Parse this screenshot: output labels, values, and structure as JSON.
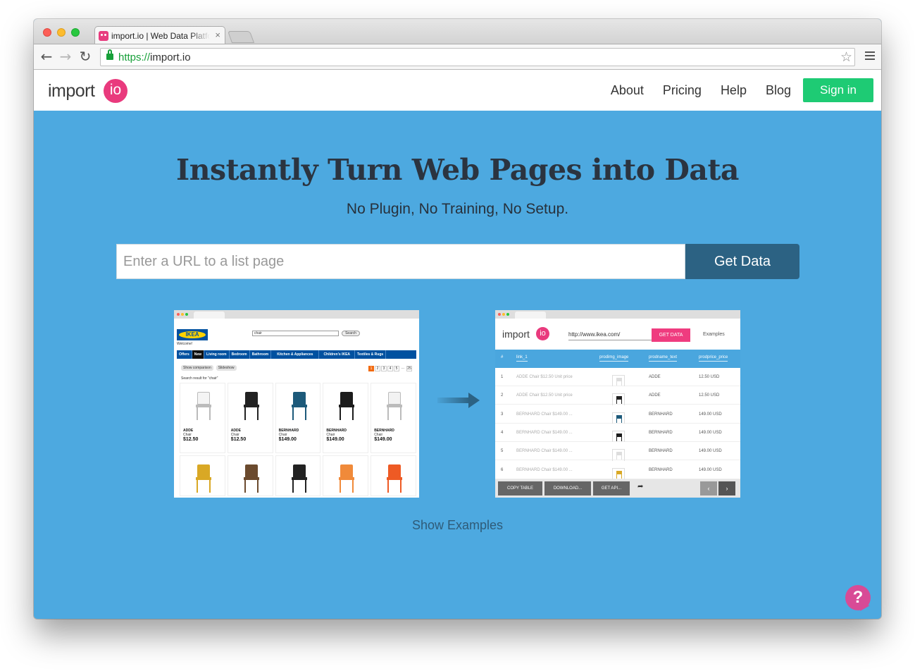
{
  "browser": {
    "tab_title": "import.io | Web Data Platform",
    "tab_close": "×",
    "url_scheme": "https://",
    "url_host": "import.io",
    "back_icon": "←",
    "forward_icon": "→",
    "reload_icon": "↻",
    "star_icon": "☆"
  },
  "header": {
    "logo_text": "import",
    "logo_badge": "io",
    "nav": [
      "About",
      "Pricing",
      "Help",
      "Blog"
    ],
    "signin_label": "Sign in"
  },
  "hero": {
    "title": "Instantly Turn Web Pages into Data",
    "subtitle": "No Plugin, No Training, No Setup.",
    "input_placeholder": "Enter a URL to a list page",
    "button_label": "Get Data"
  },
  "ikea_mock": {
    "logo": "IKEA",
    "welcome": "Welcome!",
    "search_value": "chair",
    "search_button": "Search",
    "nav": [
      "Offers",
      "New",
      "Living room",
      "Bedroom",
      "Bathroom",
      "Kitchen & Appliances",
      "Children's IKEA",
      "Textiles & Rugs"
    ],
    "pills": [
      "Show comparison",
      "Slideshow"
    ],
    "pages": [
      "1",
      "2",
      "3",
      "4",
      "5",
      "...",
      "25"
    ],
    "result_text": "Search result for \"chair\"",
    "products": [
      {
        "name": "ADDE",
        "type": "Chair",
        "price": "$12.50",
        "color": "#f4f4f4"
      },
      {
        "name": "ADDE",
        "type": "Chair",
        "price": "$12.50",
        "color": "#222222"
      },
      {
        "name": "BERNHARD",
        "type": "Chair",
        "price": "$149.00",
        "color": "#1d5a7a"
      },
      {
        "name": "BERNHARD",
        "type": "Chair",
        "price": "$149.00",
        "color": "#1c1c1c"
      },
      {
        "name": "BERNHARD",
        "type": "Chair",
        "price": "$149.00",
        "color": "#f2f2f2"
      },
      {
        "name": "",
        "type": "",
        "price": "",
        "color": "#d9a825"
      },
      {
        "name": "",
        "type": "",
        "price": "",
        "color": "#6b4a2e"
      },
      {
        "name": "",
        "type": "",
        "price": "",
        "color": "#222222"
      },
      {
        "name": "",
        "type": "",
        "price": "",
        "color": "#f08a3a"
      },
      {
        "name": "",
        "type": "",
        "price": "",
        "color": "#ee5a24"
      }
    ]
  },
  "result_mock": {
    "logo_text": "import",
    "logo_badge": "io",
    "url": "http://www.ikea.com/",
    "get_data": "GET DATA",
    "examples": "Examples",
    "columns": [
      "#",
      "link_1",
      "prodimg_image",
      "prodname_text",
      "prodprice_price"
    ],
    "rows": [
      {
        "n": "1",
        "link": "ADDE Chair $12.50 Unit price",
        "name": "ADDE",
        "price": "12.50 USD",
        "color": "#dddddd"
      },
      {
        "n": "2",
        "link": "ADDE Chair $12.50 Unit price",
        "name": "ADDE",
        "price": "12.50 USD",
        "color": "#222222"
      },
      {
        "n": "3",
        "link": "BERNHARD Chair $149.00 ...",
        "name": "BERNHARD",
        "price": "149.00 USD",
        "color": "#1d5a7a"
      },
      {
        "n": "4",
        "link": "BERNHARD Chair $149.00 ...",
        "name": "BERNHARD",
        "price": "149.00 USD",
        "color": "#1c1c1c"
      },
      {
        "n": "5",
        "link": "BERNHARD Chair $149.00 ...",
        "name": "BERNHARD",
        "price": "149.00 USD",
        "color": "#dddddd"
      },
      {
        "n": "6",
        "link": "BERNHARD Chair $149.00 ...",
        "name": "BERNHARD",
        "price": "149.00 USD",
        "color": "#d9a825"
      }
    ],
    "footer_buttons": [
      "COPY TABLE",
      "DOWNLOAD...",
      "GET API..."
    ],
    "share_icon": "➦",
    "prev_icon": "‹",
    "next_icon": "›"
  },
  "show_examples": "Show Examples",
  "help_label": "?",
  "colors": {
    "hero_bg": "#4da9e0",
    "brand_pink": "#e93a7d",
    "signin_green": "#1ecb74",
    "button_dark": "#2c6283"
  }
}
